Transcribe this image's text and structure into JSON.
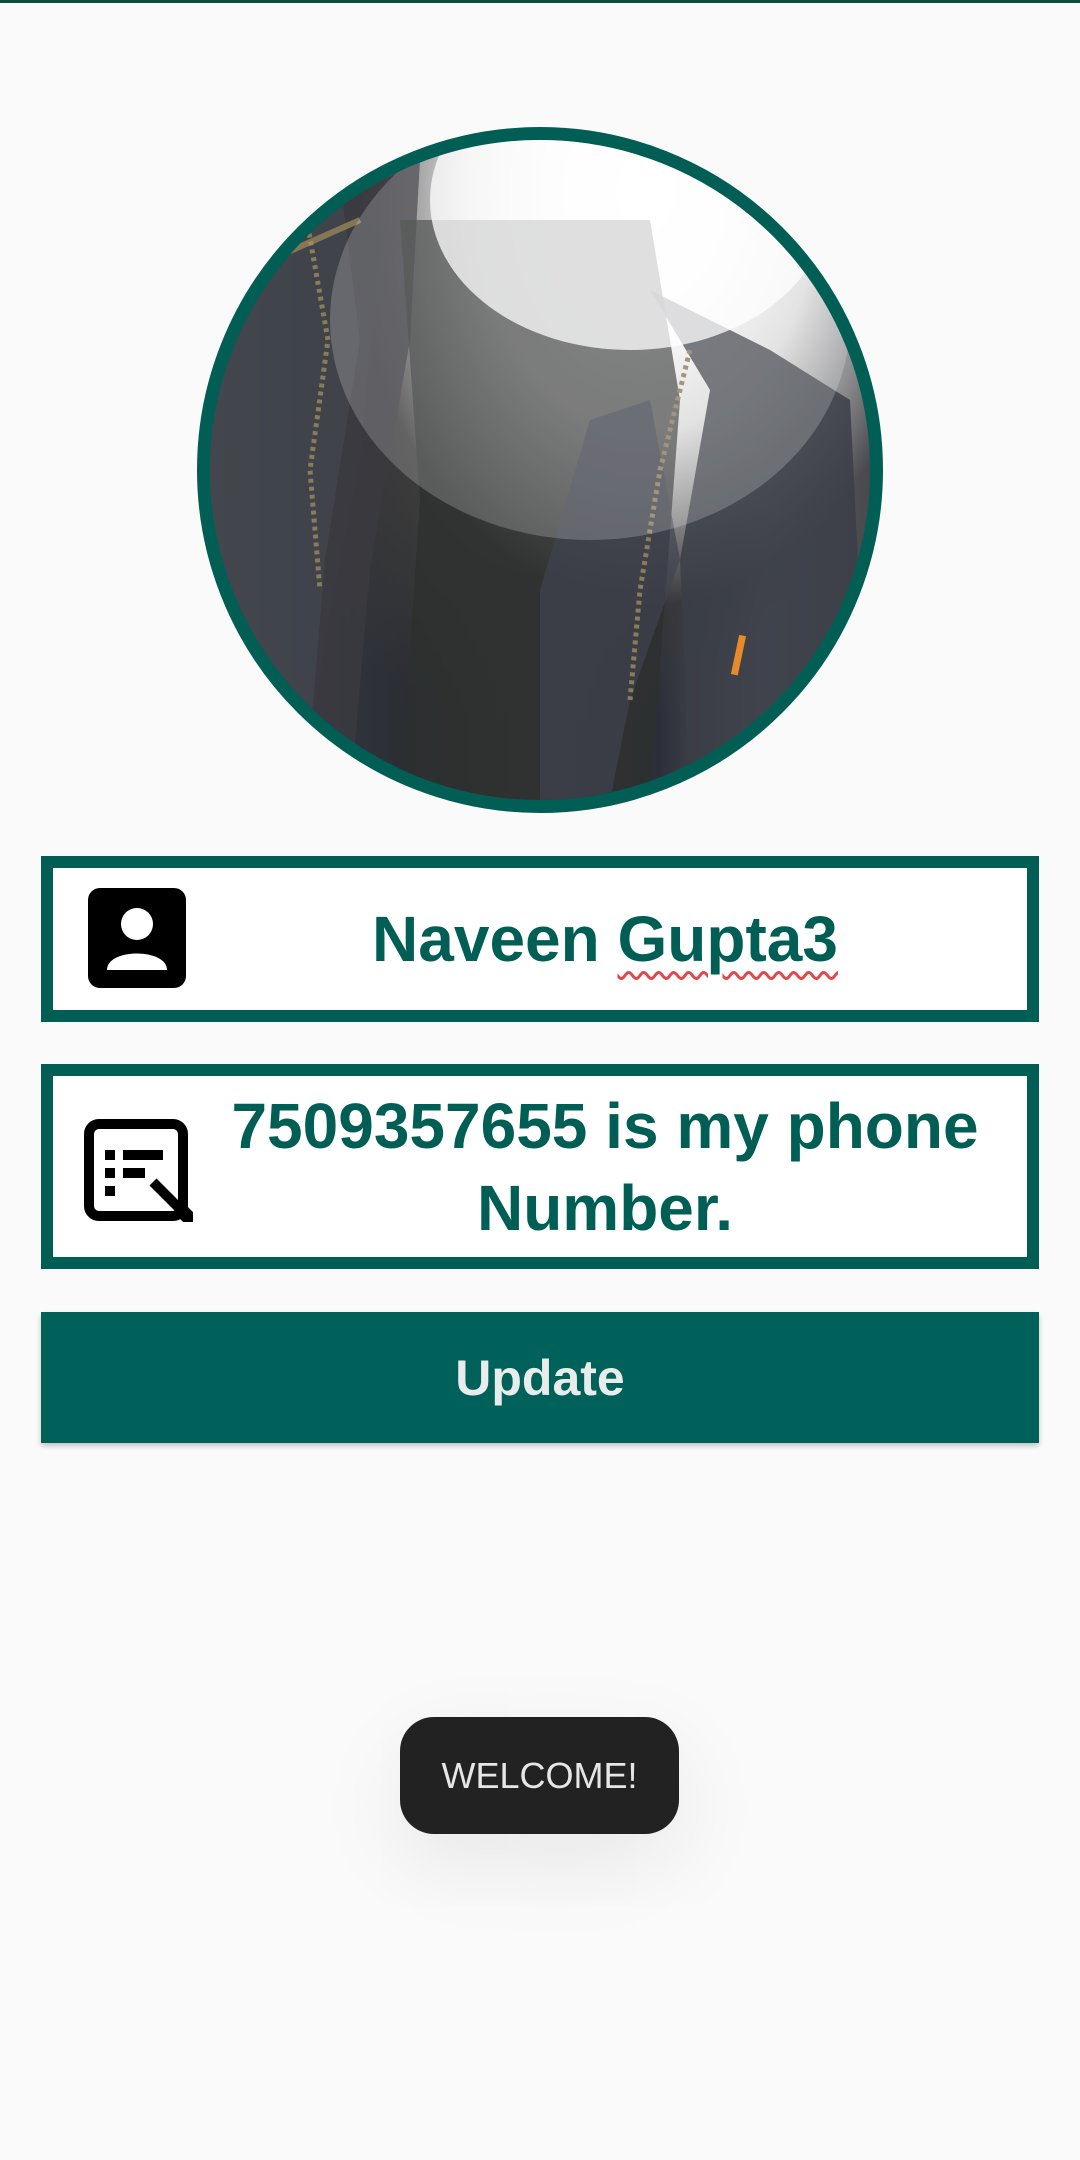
{
  "profile": {
    "photo_icon": "profile-photo",
    "name_first": "Naveen ",
    "name_last": "Gupta3",
    "name_icon": "person-badge-icon",
    "phone_text": "7509357655 is my phone Number.",
    "phone_icon": "edit-form-icon"
  },
  "actions": {
    "update_label": "Update"
  },
  "toast": {
    "message": "WELCOME!"
  },
  "colors": {
    "accent": "#005e55",
    "button": "#00615a",
    "toast_bg": "#222222",
    "spellcheck_underline": "#e0484a"
  }
}
